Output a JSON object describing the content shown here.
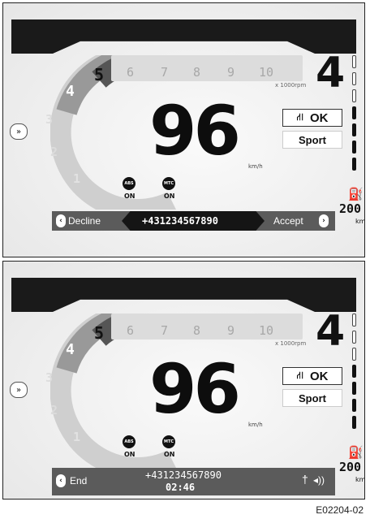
{
  "panels": [
    {
      "gear_scale": [
        "1",
        "2",
        "3",
        "4",
        "5"
      ],
      "rpm_ticks": [
        "6",
        "7",
        "8",
        "9",
        "10"
      ],
      "rpm_unit": "x 1000rpm",
      "gear": "4",
      "speed": "96",
      "speed_unit": "km/h",
      "traction_status": "OK",
      "riding_mode": "Sport",
      "fuel_range": "200",
      "range_unit": "km",
      "abs_label": "ABS",
      "abs_state": "ON",
      "mtc_label": "MTC",
      "mtc_state": "ON",
      "call": {
        "left_label": "Decline",
        "number": "+431234567890",
        "right_label": "Accept"
      }
    },
    {
      "gear_scale": [
        "1",
        "2",
        "3",
        "4",
        "5"
      ],
      "rpm_ticks": [
        "6",
        "7",
        "8",
        "9",
        "10"
      ],
      "rpm_unit": "x 1000rpm",
      "gear": "4",
      "speed": "96",
      "speed_unit": "km/h",
      "traction_status": "OK",
      "riding_mode": "Sport",
      "fuel_range": "200",
      "range_unit": "km",
      "abs_label": "ABS",
      "abs_state": "ON",
      "mtc_label": "MTC",
      "mtc_state": "ON",
      "call": {
        "left_label": "End",
        "number": "+431234567890",
        "duration": "02:46"
      }
    }
  ],
  "caption": "E02204-02",
  "icons": {
    "traction": "traction-control-icon",
    "fuel": "fuel-pump-icon",
    "side": "menu-arrow-icon",
    "volume": "volume-icon",
    "mic": "microphone-icon"
  },
  "colors": {
    "dark": "#111111",
    "bar": "#5b5b5b",
    "bg": "#f2f2f2"
  }
}
